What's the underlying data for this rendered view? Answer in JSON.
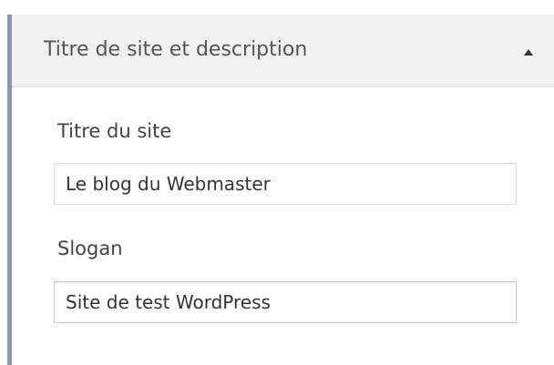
{
  "section": {
    "title": "Titre de site et description",
    "toggle_icon": "arrow-up-icon",
    "accent_color": "#8797b4"
  },
  "fields": {
    "site_title": {
      "label": "Titre du site",
      "value": "Le blog du Webmaster"
    },
    "tagline": {
      "label": "Slogan",
      "value": "Site de test WordPress"
    }
  }
}
